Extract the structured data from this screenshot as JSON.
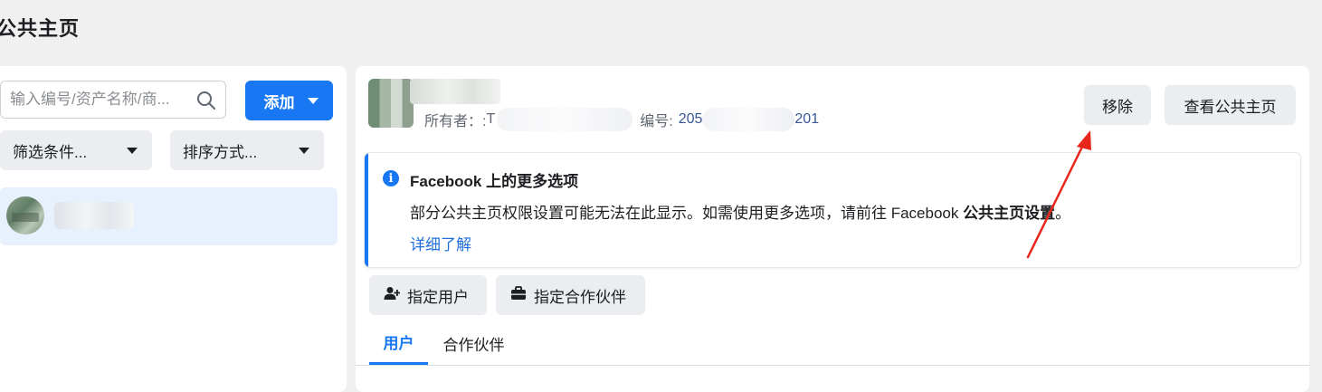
{
  "page": {
    "title": "公共主页"
  },
  "sidebar": {
    "search_placeholder": "输入编号/资产名称/商...",
    "add_label": "添加",
    "filter_label": "筛选条件...",
    "sort_label": "排序方式..."
  },
  "detail": {
    "owner_label": "所有者：:",
    "owner_visible_char": "T",
    "id_label": "编号:",
    "id_prefix": "205",
    "id_suffix": "201",
    "remove_label": "移除",
    "view_page_label": "查看公共主页"
  },
  "info": {
    "title": "Facebook 上的更多选项",
    "body_prefix": "部分公共主页权限设置可能无法在此显示。如需使用更多选项，请前往 Facebook ",
    "body_bold": "公共主页设置",
    "body_suffix": "。",
    "link": "详细了解"
  },
  "actions": {
    "assign_user": "指定用户",
    "assign_partner": "指定合作伙伴"
  },
  "tabs": [
    {
      "label": "用户",
      "active": true
    },
    {
      "label": "合作伙伴",
      "active": false
    }
  ],
  "colors": {
    "accent": "#1877f2",
    "link": "#216fdb",
    "annotation_arrow": "#e8261c"
  }
}
